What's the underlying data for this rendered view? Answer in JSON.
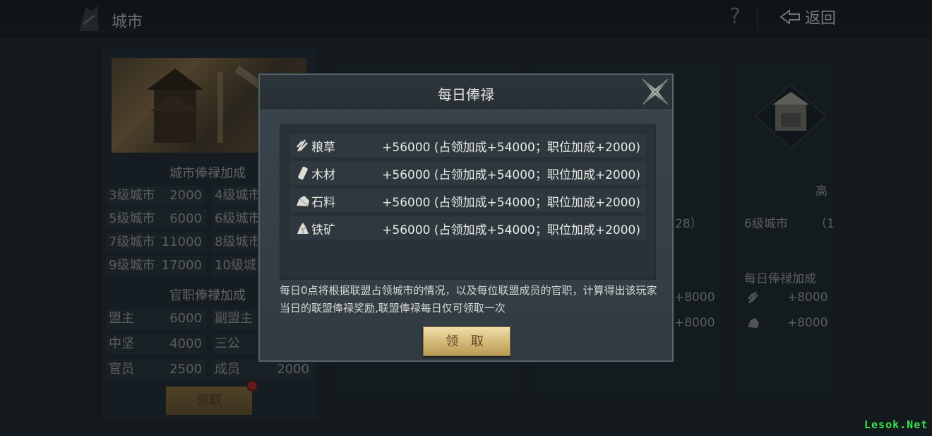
{
  "topbar": {
    "title": "城市",
    "help_icon": "question-mark-icon",
    "back_label": "返回"
  },
  "background_panel": {
    "city_bonus_title": "城市俸禄加成",
    "city_rows": [
      {
        "k1": "3级城市",
        "v1": "2000",
        "k2": "4级城市"
      },
      {
        "k1": "5级城市",
        "v1": "6000",
        "k2": "6级城市"
      },
      {
        "k1": "7级城市",
        "v1": "11000",
        "k2": "8级城市"
      },
      {
        "k1": "9级城市",
        "v1": "17000",
        "k2": "10级城"
      }
    ],
    "office_bonus_title": "官职俸禄加成",
    "office_rows": [
      {
        "k1": "盟主",
        "v1": "6000",
        "k2": "副盟主",
        "v2": ""
      },
      {
        "k1": "中坚",
        "v1": "4000",
        "k2": "三公",
        "v2": ""
      },
      {
        "k1": "官员",
        "v1": "2500",
        "k2": "成员",
        "v2": "2000"
      }
    ],
    "claim_label": "领取"
  },
  "right_panels": {
    "panel3_partial": "28）",
    "panel3_values": [
      "+8000",
      "+8000"
    ],
    "panel4_title": "高",
    "panel4_city": "6级城市",
    "panel4_paren": "（1",
    "panel4_daily_title": "每日俸禄加成",
    "panel4_values": [
      "+8000",
      "+8000"
    ]
  },
  "modal": {
    "title": "每日俸禄",
    "resources": [
      {
        "icon": "grain-icon",
        "name": "粮草",
        "value": "+56000 (占领加成+54000；职位加成+2000)"
      },
      {
        "icon": "wood-icon",
        "name": "木材",
        "value": "+56000 (占领加成+54000；职位加成+2000)"
      },
      {
        "icon": "stone-icon",
        "name": "石料",
        "value": "+56000 (占领加成+54000；职位加成+2000)"
      },
      {
        "icon": "iron-ore-icon",
        "name": "铁矿",
        "value": "+56000 (占领加成+54000；职位加成+2000)"
      }
    ],
    "description": "每日0点将根据联盟占领城市的情况，以及每位联盟成员的官职，计算得出该玩家当日的联盟俸禄奖励,联盟俸禄每日仅可领取一次",
    "claim_label": "领 取"
  },
  "watermark": "Lesok.Net",
  "colors": {
    "gold_button": "#d3b774",
    "panel_bg": "#313b42",
    "watermark": "#37e64a"
  }
}
